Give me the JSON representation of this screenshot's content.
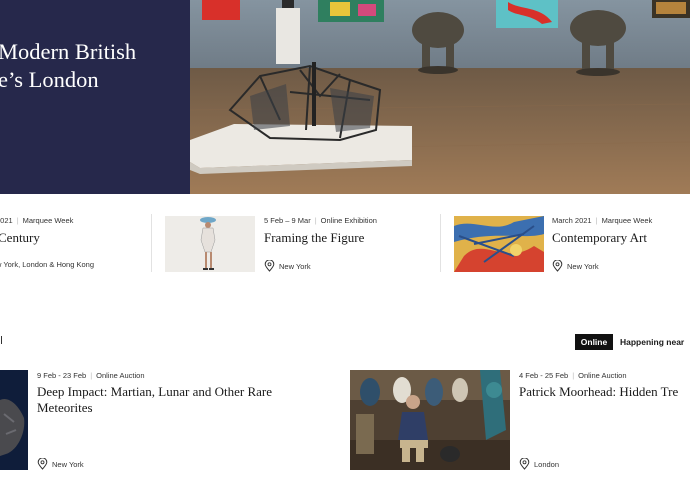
{
  "hero": {
    "title_line1": "Modern British",
    "title_line2": "e’s London",
    "panel_color": "#26284b"
  },
  "features": [
    {
      "meta_date": "2021",
      "meta_type": "Marquee Week",
      "title": "Century",
      "location": "w York, London & Hong Kong",
      "has_pin": false
    },
    {
      "meta_date": "5 Feb – 9 Mar",
      "meta_type": "Online Exhibition",
      "title": "Framing the Figure",
      "location": "New York",
      "has_pin": true
    },
    {
      "meta_date": "March 2021",
      "meta_type": "Marquee Week",
      "title": "Contemporary Art",
      "location": "New York",
      "has_pin": true
    }
  ],
  "section": {
    "online_badge": "Online",
    "near_tab": "Happening near"
  },
  "auctions": [
    {
      "meta_date": "9 Feb - 23 Feb",
      "meta_type": "Online Auction",
      "title_line1": "Deep Impact: Martian, Lunar and Other Rare",
      "title_line2": "Meteorites",
      "location": "New York"
    },
    {
      "meta_date": "4 Feb - 25 Feb",
      "meta_type": "Online Auction",
      "title_line1": "Patrick Moorhead: Hidden Tre",
      "title_line2": "",
      "location": "London"
    }
  ],
  "icons": {
    "location": "location-pin-icon"
  },
  "colors": {
    "navy": "#26284b",
    "badge_bg": "#111111",
    "text": "#1a1a1a"
  }
}
